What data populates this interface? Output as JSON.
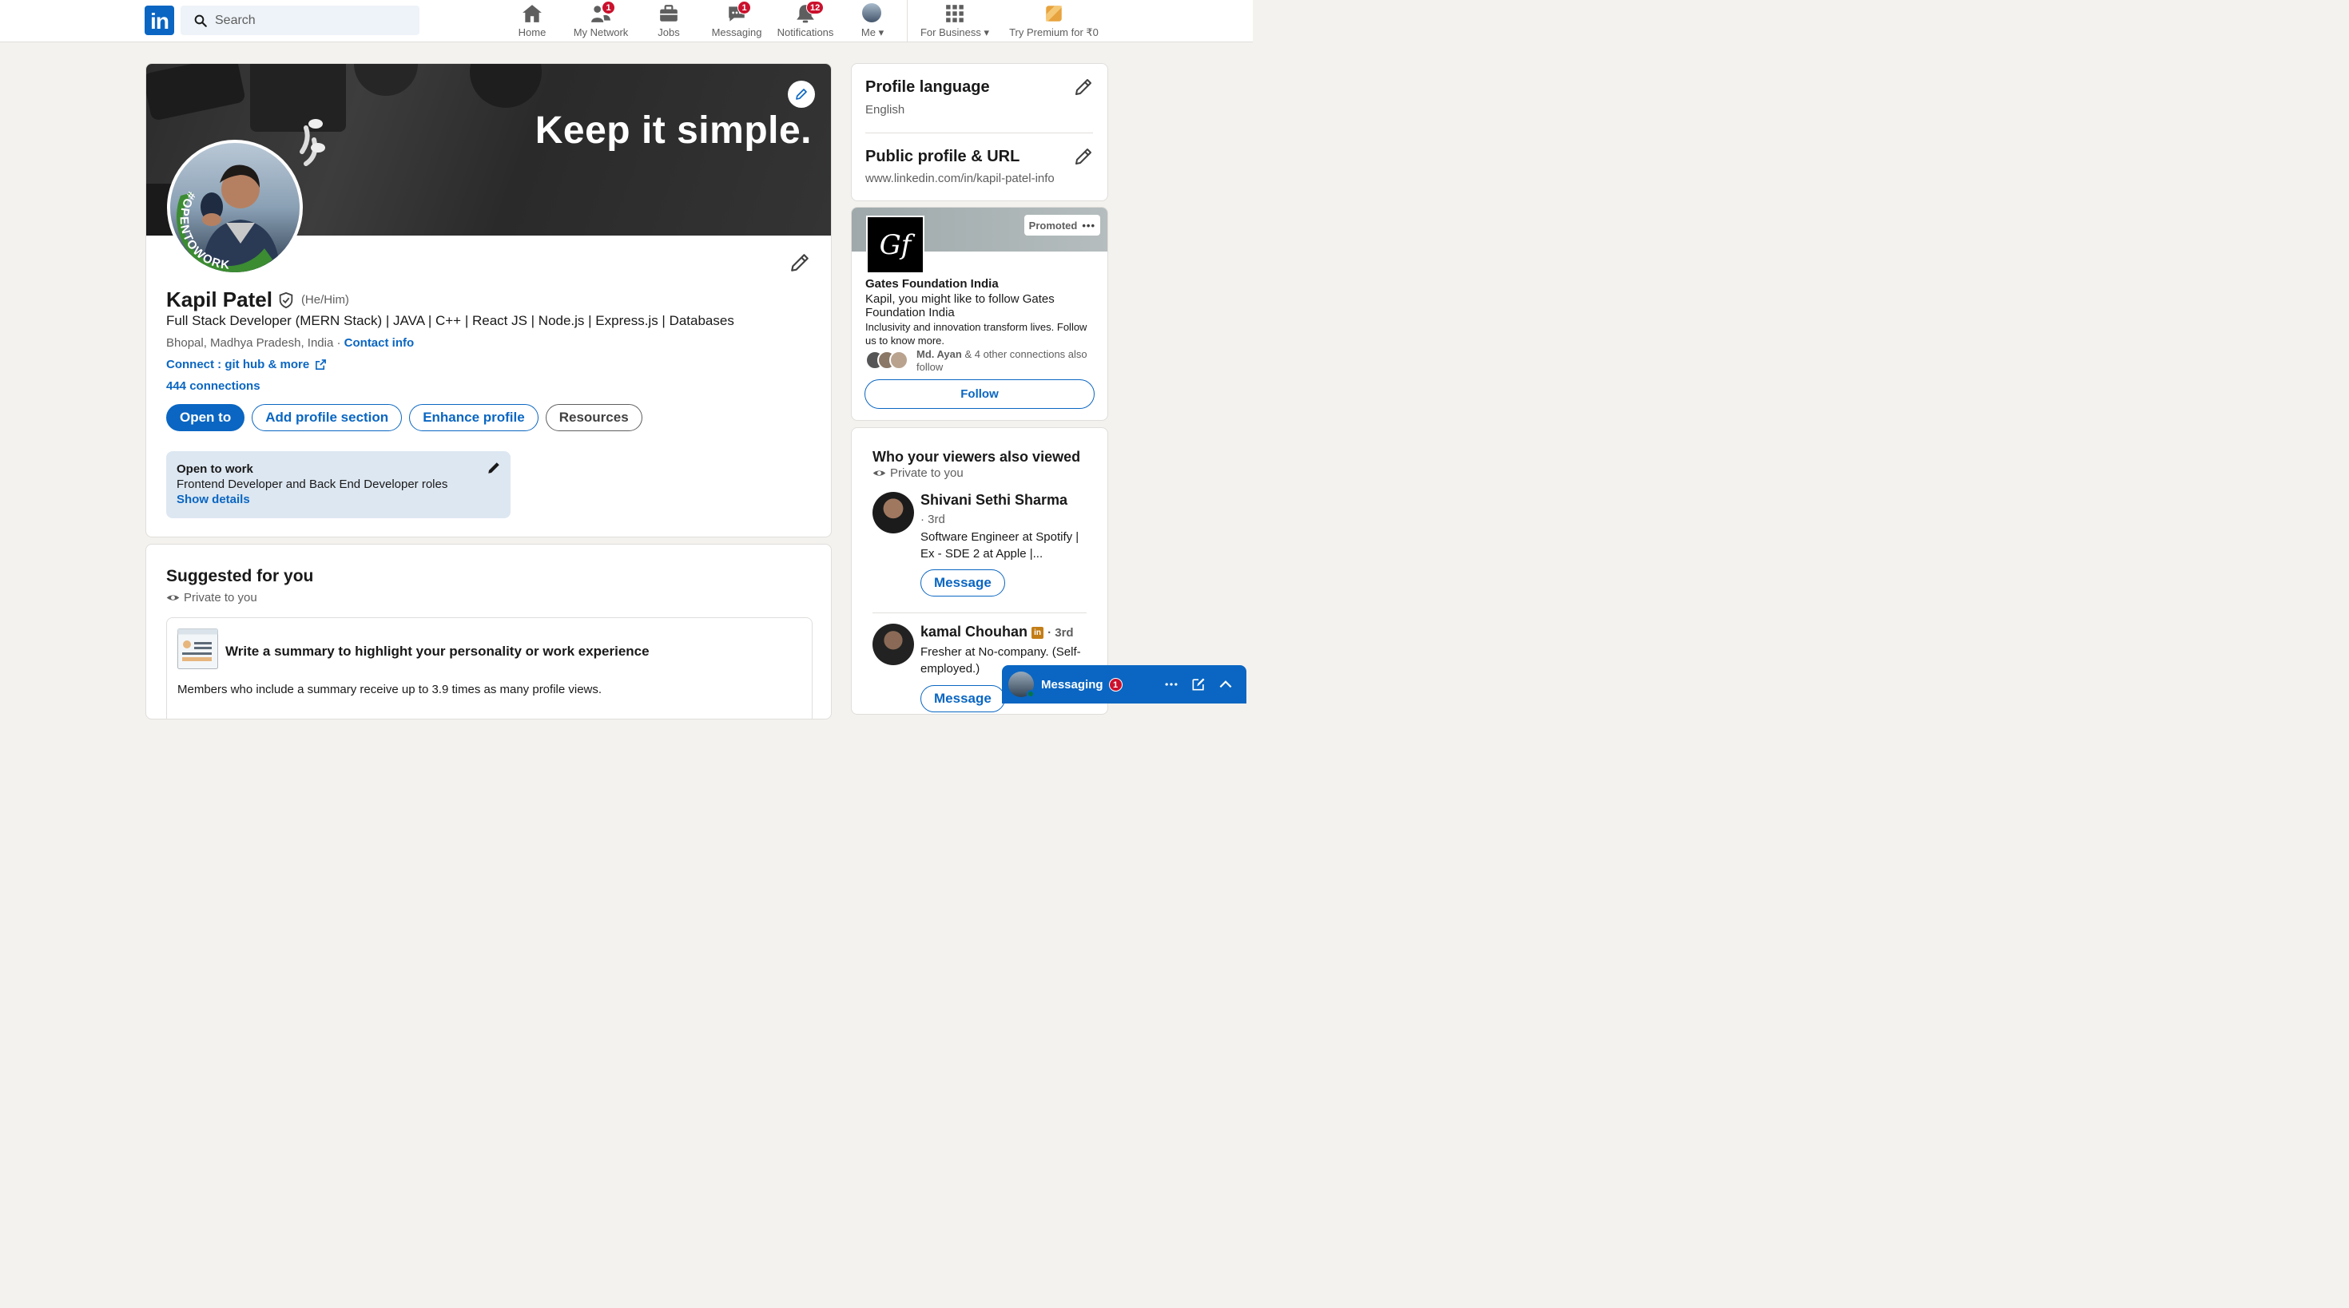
{
  "nav": {
    "search_placeholder": "Search",
    "items": [
      {
        "label": "Home",
        "icon": "home-icon",
        "badge": ""
      },
      {
        "label": "My Network",
        "icon": "network-icon",
        "badge": "1"
      },
      {
        "label": "Jobs",
        "icon": "briefcase-icon",
        "badge": ""
      },
      {
        "label": "Messaging",
        "icon": "messaging-icon",
        "badge": "1"
      },
      {
        "label": "Notifications",
        "icon": "bell-icon",
        "badge": "12"
      },
      {
        "label": "Me",
        "icon": "avatar",
        "badge": ""
      },
      {
        "label": "For Business",
        "icon": "grid-icon",
        "badge": ""
      },
      {
        "label": "Try Premium for ₹0",
        "icon": "premium-icon",
        "badge": ""
      }
    ]
  },
  "profile": {
    "banner_text": "Keep it simple.",
    "open_to_work_ring": "#OPENTOWORK",
    "name": "Kapil Patel",
    "pronouns": "(He/Him)",
    "headline": "Full Stack Developer (MERN Stack) | JAVA | C++ | React JS | Node.js | Express.js | Databases",
    "location": "Bhopal, Madhya Pradesh, India",
    "location_sep": " · ",
    "contact_info": "Contact info",
    "custom_link": "Connect : git hub & more",
    "connections": "444 connections",
    "buttons": {
      "open_to": "Open to",
      "add_section": "Add profile section",
      "enhance": "Enhance profile",
      "resources": "Resources"
    },
    "open_to_work": {
      "title": "Open to work",
      "roles": "Frontend Developer and Back End Developer roles",
      "show_details": "Show details"
    }
  },
  "suggested": {
    "title": "Suggested for you",
    "private": "Private to you",
    "card_title": "Write a summary to highlight your personality or work experience",
    "card_body": "Members who include a summary receive up to 3.9 times as many profile views."
  },
  "rail": {
    "profile_language": {
      "title": "Profile language",
      "value": "English"
    },
    "public_profile": {
      "title": "Public profile & URL",
      "value": "www.linkedin.com/in/kapil-patel-info"
    },
    "ad": {
      "promoted": "Promoted",
      "logo_text": "Gf",
      "org": "Gates Foundation India",
      "message": "Kapil, you might like to follow Gates Foundation India",
      "description": "Inclusivity and innovation transform lives. Follow us to know more.",
      "connection_name": "Md. Ayan",
      "connection_rest": " & 4 other connections also follow",
      "follow": "Follow"
    },
    "viewers": {
      "title": "Who your viewers also viewed",
      "private": "Private to you",
      "people": [
        {
          "name": "Shivani Sethi Sharma",
          "degree": "· 3rd",
          "headline": "Software Engineer at Spotify | Ex - SDE 2 at Apple |...",
          "action": "Message"
        },
        {
          "name": "kamal Chouhan",
          "degree": "· 3rd",
          "headline": "Fresher at No-company. (Self-employed.)",
          "action": "Message"
        }
      ]
    }
  },
  "messaging_dock": {
    "label": "Messaging",
    "badge": "1"
  },
  "colors": {
    "brand": "#0a66c2",
    "badge": "#cb112d",
    "page_bg": "#f4f2ee"
  }
}
